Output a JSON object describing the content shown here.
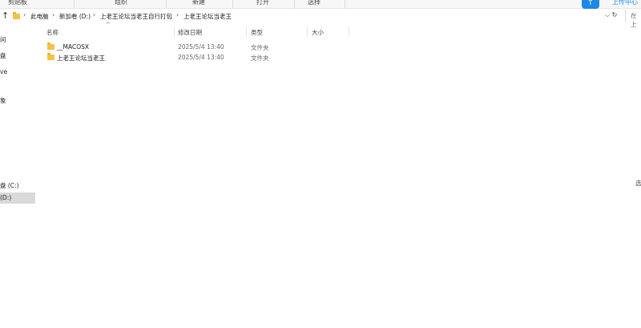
{
  "ribbon": {
    "groups": [
      "剪贴板",
      "组织",
      "新建",
      "打开",
      "选择"
    ],
    "upload_icon": "upload-arrow-icon",
    "upload_label": "上传中心"
  },
  "address": {
    "up_icon": "up-arrow-icon",
    "crumbs": [
      "此电脑",
      "新加卷 (D:)",
      "上老王论坛当老王自行打包",
      "上老王论坛当老王"
    ],
    "chevron": "›",
    "dropdown_icon": "chevron-down-icon",
    "refresh_icon": "refresh-icon",
    "search_placeholder": "在 上"
  },
  "sidebar": {
    "items": [
      "问",
      "盘",
      "ve",
      "象",
      "盘 (C:)",
      "(D:)"
    ]
  },
  "columns": {
    "name": "名称",
    "date": "修改日期",
    "type": "类型",
    "size": "大小"
  },
  "files": [
    {
      "name": "__MACOSX",
      "date": "2025/5/4 13:40",
      "type": "文件夹"
    },
    {
      "name": "上老王论坛当老王",
      "date": "2025/5/4 13:40",
      "type": "文件夹"
    }
  ],
  "right_edge_text": "选"
}
